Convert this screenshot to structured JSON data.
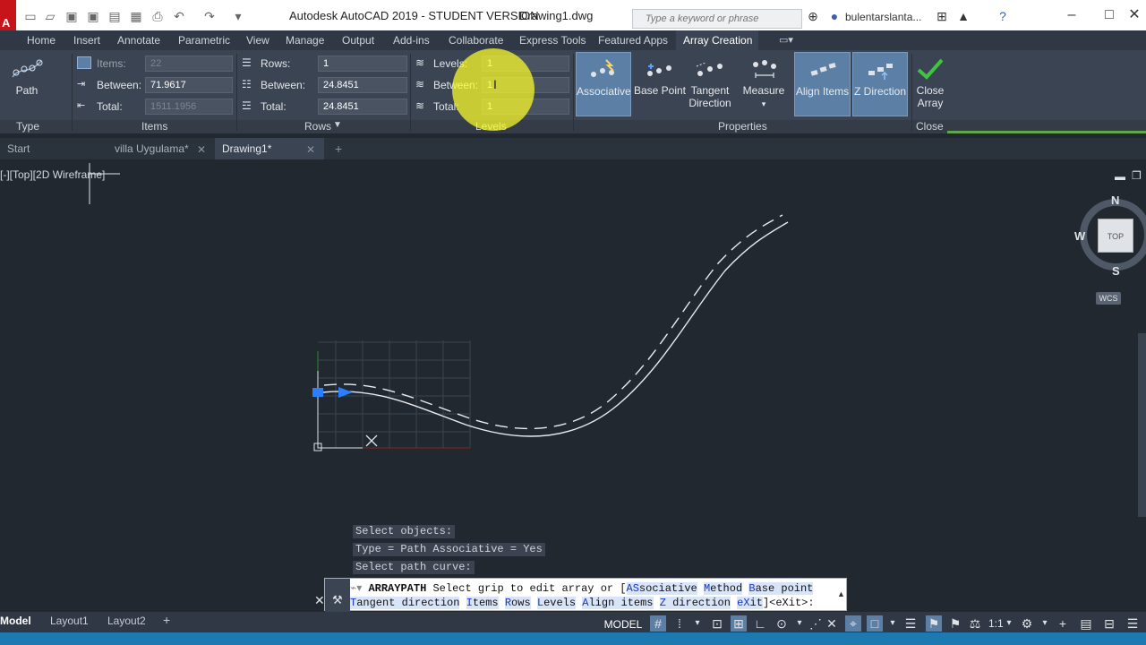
{
  "titlebar": {
    "app_title": "Autodesk AutoCAD 2019 - STUDENT VERSION",
    "file_name": "Drawing1.dwg",
    "search_placeholder": "Type a keyword or phrase",
    "user": "bulentarslanta..."
  },
  "menu_tabs": [
    "Home",
    "Insert",
    "Annotate",
    "Parametric",
    "View",
    "Manage",
    "Output",
    "Add-ins",
    "Collaborate",
    "Express Tools",
    "Featured Apps",
    "Array Creation"
  ],
  "ribbon": {
    "type_panel": {
      "button": "Path",
      "label": "Type"
    },
    "items_panel": {
      "label": "Items",
      "items_label": "Items:",
      "items_value": "22",
      "between_label": "Between:",
      "between_value": "71.9617",
      "total_label": "Total:",
      "total_value": "1511.1956"
    },
    "rows_panel": {
      "label": "Rows",
      "rows_label": "Rows:",
      "rows_value": "1",
      "between_label": "Between:",
      "between_value": "24.8451",
      "total_label": "Total:",
      "total_value": "24.8451"
    },
    "levels_panel": {
      "label": "Levels",
      "levels_label": "Levels:",
      "levels_value": "1",
      "between_label": "Between:",
      "between_value": "1",
      "total_label": "Total:",
      "total_value": "1"
    },
    "properties_panel": {
      "label": "Properties",
      "associative": "Associative",
      "base_point": "Base Point",
      "tangent_line1": "Tangent",
      "tangent_line2": "Direction",
      "measure": "Measure",
      "align_items": "Align Items",
      "z_direction": "Z Direction"
    },
    "close_panel": {
      "label": "Close",
      "line1": "Close",
      "line2": "Array"
    }
  },
  "doc_tabs": [
    "Start",
    "villa Uygulama*",
    "Drawing1*"
  ],
  "viewport": {
    "label": "[-][Top][2D Wireframe]",
    "compass_n": "N",
    "compass_s": "S",
    "compass_w": "W",
    "cube_face": "TOP",
    "wcs": "WCS"
  },
  "command": {
    "history": [
      "Select objects:",
      "Type = Path  Associative = Yes",
      "Select path curve:"
    ],
    "prompt_cmd": "ARRAYPATH",
    "prompt_text": "Select grip to edit array or [",
    "options_line1": [
      {
        "hk": "AS",
        "rest": "sociative"
      },
      {
        "hk": "M",
        "rest": "ethod"
      },
      {
        "hk": "B",
        "rest": "ase point"
      }
    ],
    "options_line2": [
      {
        "hk": "T",
        "rest": "angent direction"
      },
      {
        "hk": "I",
        "rest": "tems"
      },
      {
        "hk": "R",
        "rest": "ows"
      },
      {
        "hk": "L",
        "rest": "evels"
      },
      {
        "hk": "A",
        "rest": "lign items"
      },
      {
        "hk": "Z",
        "rest": " direction"
      },
      {
        "hk": "eX",
        "rest": "it"
      }
    ],
    "prompt_end": "]<eXit>:"
  },
  "status": {
    "layouts": [
      "Model",
      "Layout1",
      "Layout2"
    ],
    "model_btn": "MODEL",
    "scale": "1:1"
  }
}
